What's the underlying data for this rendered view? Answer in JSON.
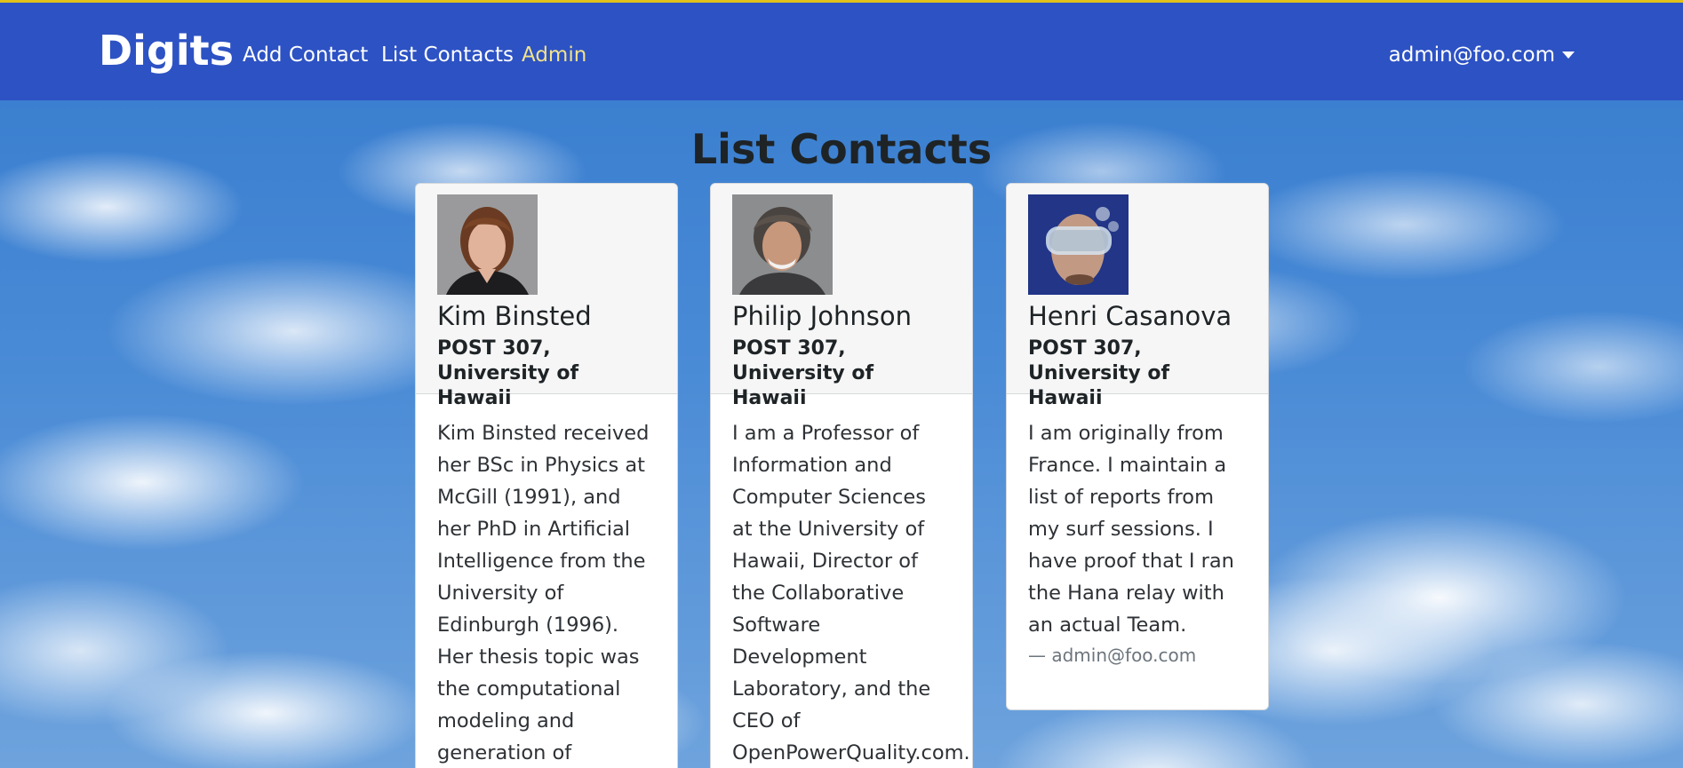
{
  "navbar": {
    "brand": "Digits",
    "links": [
      "Add Contact",
      "List Contacts",
      "Admin"
    ],
    "user": "admin@foo.com"
  },
  "page": {
    "title": "List Contacts"
  },
  "contacts": [
    {
      "name": "Kim Binsted",
      "address": "POST 307, University of Hawaii",
      "description": "Kim Binsted received her BSc in Physics at McGill (1991), and her PhD in Artificial Intelligence from the University of Edinburgh (1996). Her thesis topic was the computational modeling and generation of punning"
    },
    {
      "name": "Philip Johnson",
      "address": "POST 307, University of Hawaii",
      "description": "I am a Professor of Information and Computer Sciences at the University of Hawaii, Director of the Collaborative Software Development Laboratory, and the CEO of OpenPowerQuality.com."
    },
    {
      "name": "Henri Casanova",
      "address": "POST 307, University of Hawaii",
      "description": "I am originally from France. I maintain a list of reports from my surf sessions. I have proof that I ran the Hana relay with an actual Team.",
      "note_author": "— admin@foo.com"
    }
  ],
  "icons": {
    "user_menu_caret": "chevron-down-icon"
  },
  "colors": {
    "navbar": "#2d52c4",
    "accent_line": "#e0c21b",
    "active_link": "#f2e28a"
  }
}
